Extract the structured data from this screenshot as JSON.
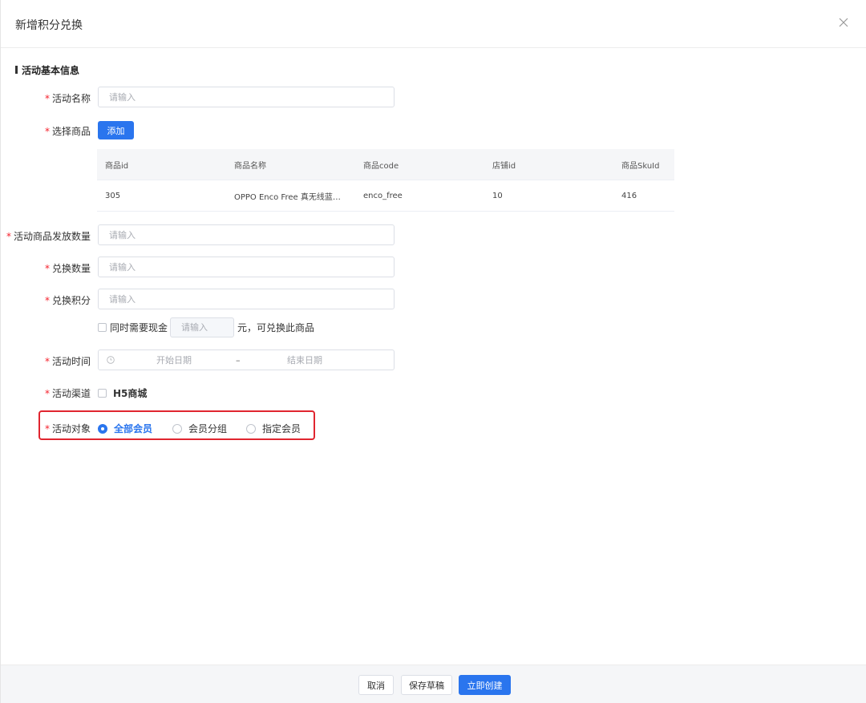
{
  "header": {
    "title": "新增积分兑换"
  },
  "section": {
    "title": "活动基本信息"
  },
  "form": {
    "activity_name": {
      "label": "活动名称",
      "placeholder": "请输入",
      "value": ""
    },
    "select_product": {
      "label": "选择商品",
      "add_button": "添加"
    },
    "issue_quantity": {
      "label": "活动商品发放数量",
      "placeholder": "请输入"
    },
    "exchange_quantity": {
      "label": "兑换数量",
      "placeholder": "请输入"
    },
    "exchange_points": {
      "label": "兑换积分",
      "placeholder": "请输入"
    },
    "cash": {
      "prefix": "同时需要现金",
      "placeholder": "请输入",
      "suffix": "元，可兑换此商品",
      "checked": false
    },
    "activity_time": {
      "label": "活动时间",
      "start_placeholder": "开始日期",
      "separator": "–",
      "end_placeholder": "结束日期"
    },
    "channel": {
      "label": "活动渠道",
      "option": "H5商城",
      "checked": false
    },
    "target": {
      "label": "活动对象",
      "options": [
        {
          "label": "全部会员",
          "selected": true
        },
        {
          "label": "会员分组",
          "selected": false
        },
        {
          "label": "指定会员",
          "selected": false
        }
      ]
    }
  },
  "product_table": {
    "columns": [
      "商品id",
      "商品名称",
      "商品code",
      "店铺id",
      "商品SkuId"
    ],
    "rows": [
      [
        "305",
        "OPPO Enco Free 真无线蓝牙耳机",
        "enco_free",
        "10",
        "416"
      ]
    ]
  },
  "footer": {
    "cancel": "取消",
    "save_draft": "保存草稿",
    "create_now": "立即创建"
  },
  "colors": {
    "primary": "#2a75ee",
    "required": "#f5222d",
    "highlight_border": "#e0252f"
  },
  "icons": {
    "close": "close-icon",
    "clock": "clock-icon"
  }
}
